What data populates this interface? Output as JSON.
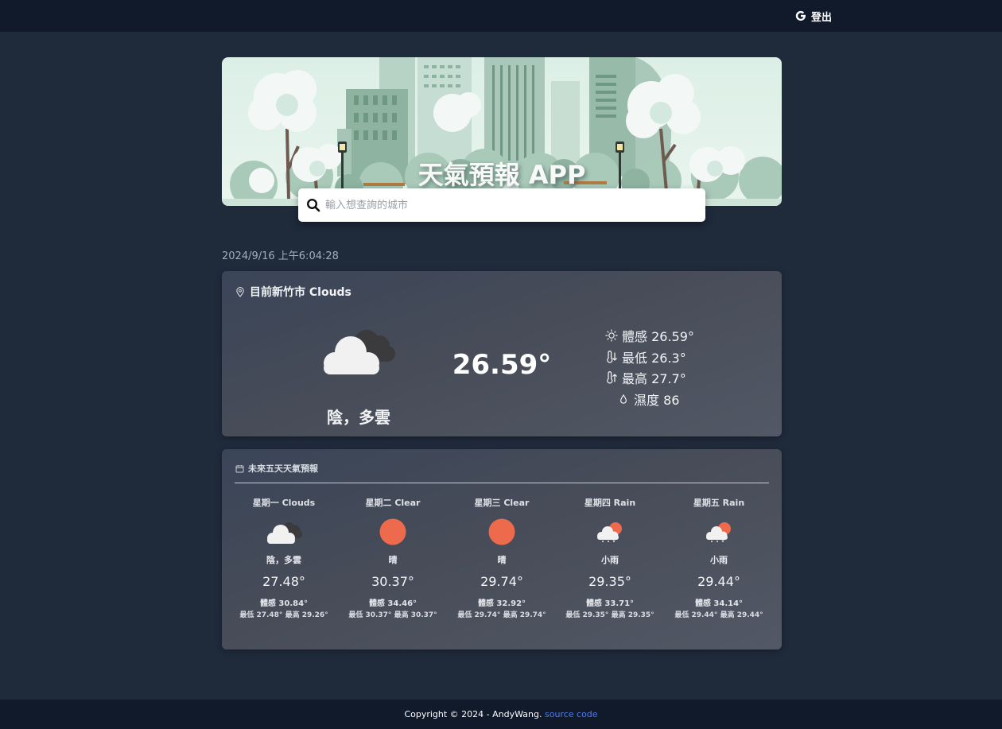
{
  "header": {
    "logout_label": "登出",
    "logout_icon": "google-icon"
  },
  "banner": {
    "title": "天氣預報 APP"
  },
  "search": {
    "placeholder": "輸入想查詢的城市",
    "value": ""
  },
  "datetime": "2024/9/16 上午6:04:28",
  "current": {
    "title": "目前新竹市 Clouds",
    "description": "陰，多雲",
    "temperature": "26.59°",
    "feels_like": "體感 26.59°",
    "min": "最低 26.3°",
    "max": "最高 27.7°",
    "humidity": "濕度 86",
    "icon": "clouds-icon"
  },
  "forecast": {
    "title": "未來五天天氣預報",
    "days": [
      {
        "day": "星期一 Clouds",
        "icon": "clouds-icon",
        "desc": "陰，多雲",
        "temp": "27.48°",
        "feel": "體感 30.84°",
        "range": "最低 27.48°  最高 29.26°"
      },
      {
        "day": "星期二 Clear",
        "icon": "sun-icon",
        "desc": "晴",
        "temp": "30.37°",
        "feel": "體感 34.46°",
        "range": "最低 30.37°  最高 30.37°"
      },
      {
        "day": "星期三 Clear",
        "icon": "sun-icon",
        "desc": "晴",
        "temp": "29.74°",
        "feel": "體感 32.92°",
        "range": "最低 29.74°  最高 29.74°"
      },
      {
        "day": "星期四 Rain",
        "icon": "rain-icon",
        "desc": "小雨",
        "temp": "29.35°",
        "feel": "體感 33.71°",
        "range": "最低 29.35°  最高 29.35°"
      },
      {
        "day": "星期五 Rain",
        "icon": "rain-icon",
        "desc": "小雨",
        "temp": "29.44°",
        "feel": "體感 34.14°",
        "range": "最低 29.44°  最高 29.44°"
      }
    ]
  },
  "footer": {
    "copyright": "Copyright © 2024 - AndyWang.",
    "link_label": "source code"
  },
  "colors": {
    "background": "#1f2a3b",
    "topbar": "#111a2a",
    "sun": "#ee6a4c",
    "link": "#4f7df0"
  }
}
